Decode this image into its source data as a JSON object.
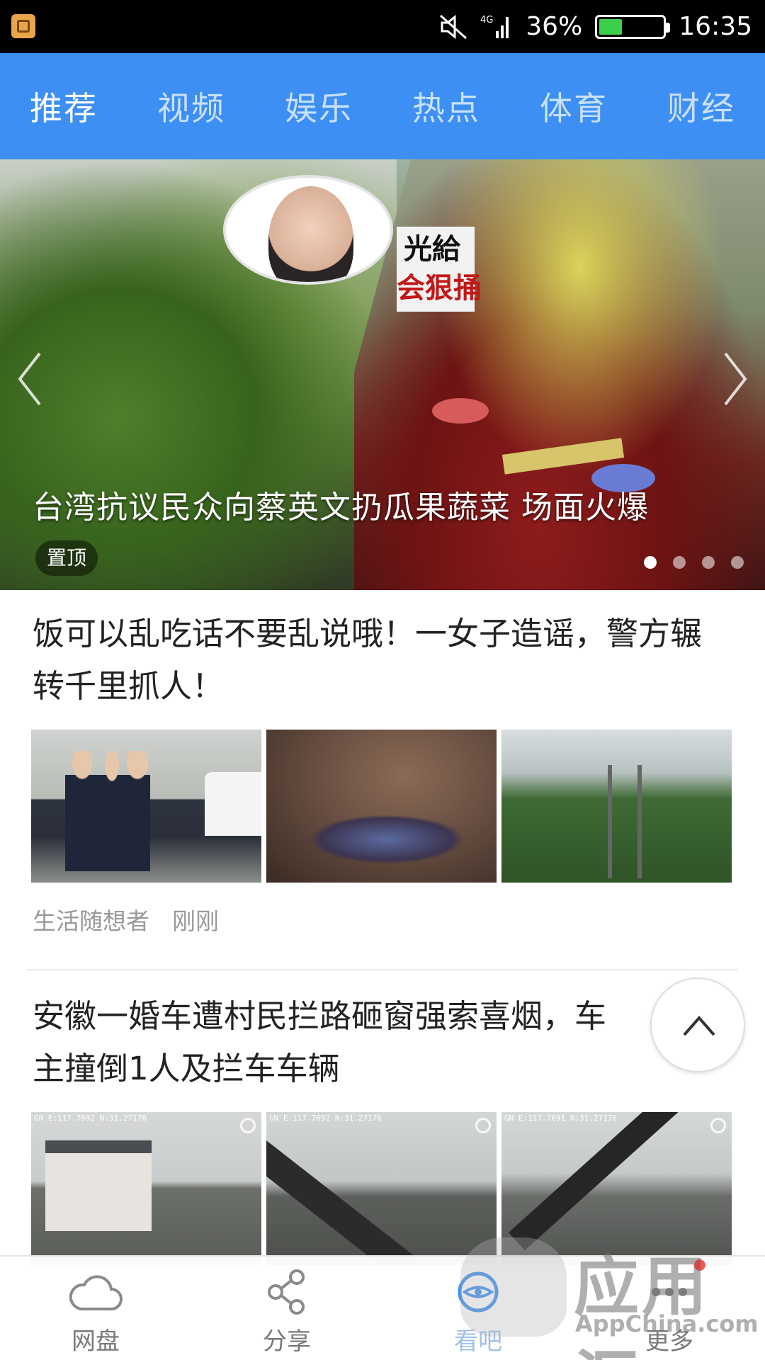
{
  "status_bar": {
    "battery_percent": "36%",
    "time": "16:35",
    "network": "4G",
    "battery_level": 0.36
  },
  "tabs": [
    {
      "label": "推荐",
      "active": true
    },
    {
      "label": "视频",
      "active": false
    },
    {
      "label": "娱乐",
      "active": false
    },
    {
      "label": "热点",
      "active": false
    },
    {
      "label": "体育",
      "active": false
    },
    {
      "label": "财经",
      "active": false
    }
  ],
  "banner": {
    "title": "台湾抗议民众向蔡英文扔瓜果蔬菜 场面火爆",
    "badge": "置顶",
    "dots_total": 4,
    "dots_active": 1,
    "image_text_1": "光給",
    "image_text_2": "会狠捅"
  },
  "articles": [
    {
      "title": "饭可以乱吃话不要乱说哦！一女子造谣，警方辗转千里抓人！",
      "author": "生活随想者",
      "time": "刚刚"
    },
    {
      "title": "安徽一婚车遭村民拦路砸窗强索喜烟，车主撞倒1人及拦车车辆",
      "cam_overlay": [
        "GN E:117.7692 N:31.27176",
        "GN E:117.7692 N:31.27176",
        "GN E:117.7691 N:31.27176"
      ]
    }
  ],
  "bottom_nav": [
    {
      "label": "网盘",
      "icon": "cloud-icon"
    },
    {
      "label": "分享",
      "icon": "share-icon"
    },
    {
      "label": "看吧",
      "icon": "eye-icon",
      "active": true
    },
    {
      "label": "更多",
      "icon": "more-icon"
    }
  ],
  "watermark": {
    "title": "应用汇",
    "subtitle": "AppChina.com"
  },
  "colors": {
    "tab_bar": "#3d8ff3",
    "status_bar": "#000000",
    "meta_text": "#999999"
  }
}
